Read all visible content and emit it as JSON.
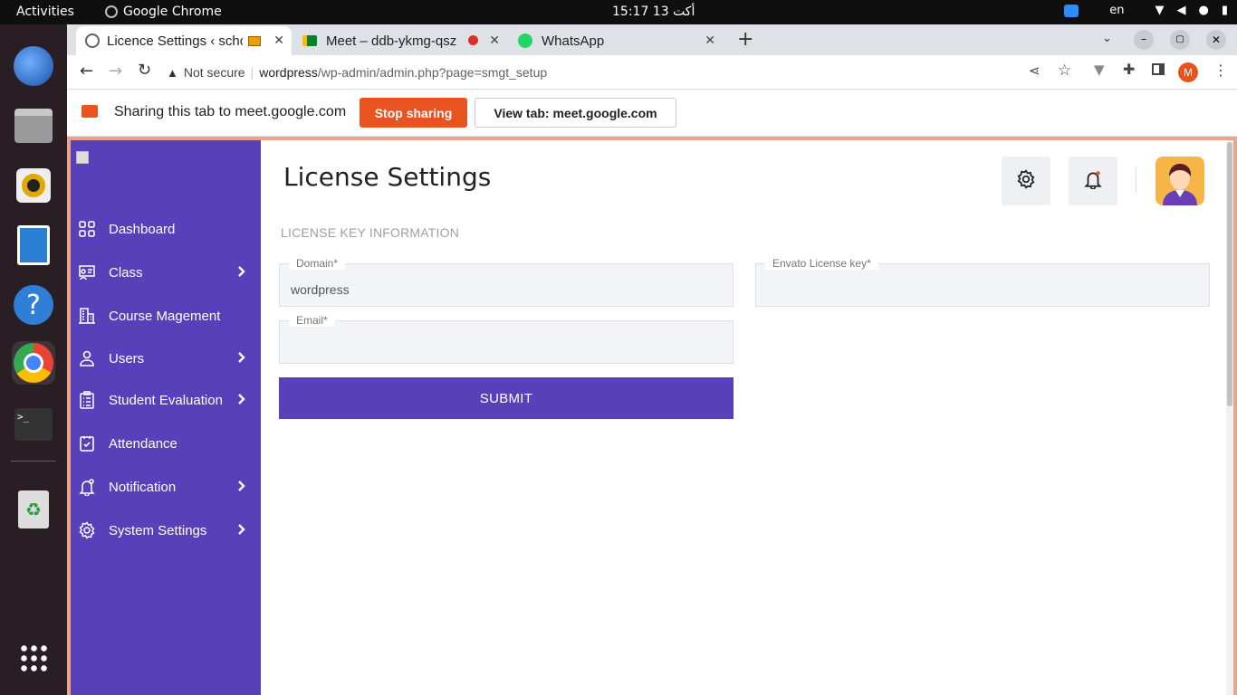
{
  "os": {
    "activities": "Activities",
    "app_name": "Google Chrome",
    "clock": "15:17  13 أكت",
    "lang": "en"
  },
  "browser": {
    "tabs": [
      {
        "title": "Licence Settings ‹ scho",
        "active": true
      },
      {
        "title": "Meet – ddb-ykmg-qsz",
        "active": false
      },
      {
        "title": "WhatsApp",
        "active": false
      }
    ],
    "security_label": "Not secure",
    "url_host": "wordpress",
    "url_path": "/wp-admin/admin.php?page=smgt_setup",
    "profile_initial": "M"
  },
  "sharebar": {
    "message": "Sharing this tab to meet.google.com",
    "stop_label": "Stop sharing",
    "view_label": "View tab: meet.google.com"
  },
  "sidebar": {
    "items": [
      {
        "label": "Dashboard",
        "icon": "grid-icon",
        "has_submenu": false
      },
      {
        "label": "Class",
        "icon": "class-icon",
        "has_submenu": true
      },
      {
        "label": "Course Magement",
        "icon": "building-icon",
        "has_submenu": false
      },
      {
        "label": "Users",
        "icon": "user-icon",
        "has_submenu": true
      },
      {
        "label": "Student Evaluation",
        "icon": "clipboard-icon",
        "has_submenu": true
      },
      {
        "label": "Attendance",
        "icon": "check-square-icon",
        "has_submenu": false
      },
      {
        "label": "Notification",
        "icon": "bell-icon",
        "has_submenu": true
      },
      {
        "label": "System Settings",
        "icon": "gear-icon",
        "has_submenu": true
      }
    ]
  },
  "page": {
    "title": "License Settings",
    "section_heading": "LICENSE KEY INFORMATION",
    "fields": {
      "domain": {
        "label": "Domain*",
        "value": "wordpress"
      },
      "envato": {
        "label": "Envato License key*",
        "value": ""
      },
      "email": {
        "label": "Email*",
        "value": ""
      }
    },
    "submit_label": "SUBMIT"
  },
  "colors": {
    "brand": "#5840bb",
    "stop_sharing": "#e8531f",
    "share_border": "#e9a58a"
  }
}
